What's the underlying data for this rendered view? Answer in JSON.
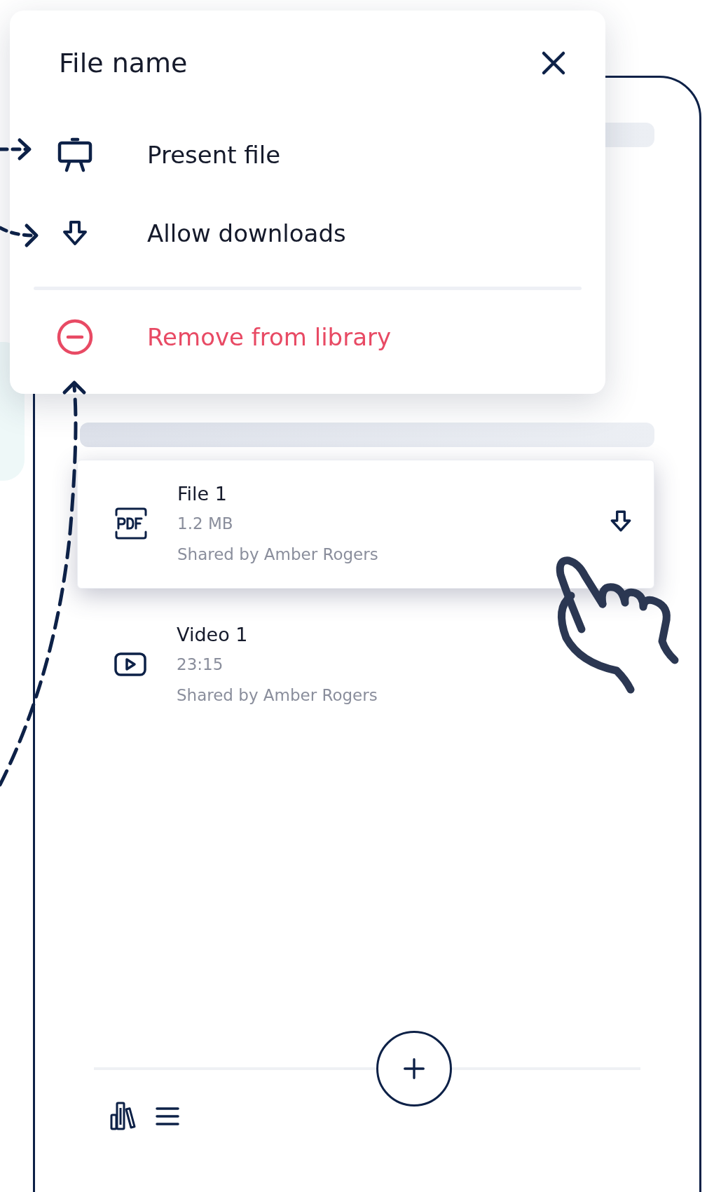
{
  "menu": {
    "title": "File name",
    "items": [
      {
        "kind": "present",
        "label": "Present file"
      },
      {
        "kind": "download",
        "label": "Allow downloads"
      },
      {
        "kind": "remove",
        "label": "Remove from library"
      }
    ]
  },
  "files": [
    {
      "kind": "pdf",
      "name": "File 1",
      "meta": "1.2 MB",
      "shared": "Shared by Amber Rogers",
      "selected": true
    },
    {
      "kind": "video",
      "name": "Video 1",
      "meta": "23:15",
      "shared": "Shared by Amber Rogers",
      "selected": false
    }
  ]
}
